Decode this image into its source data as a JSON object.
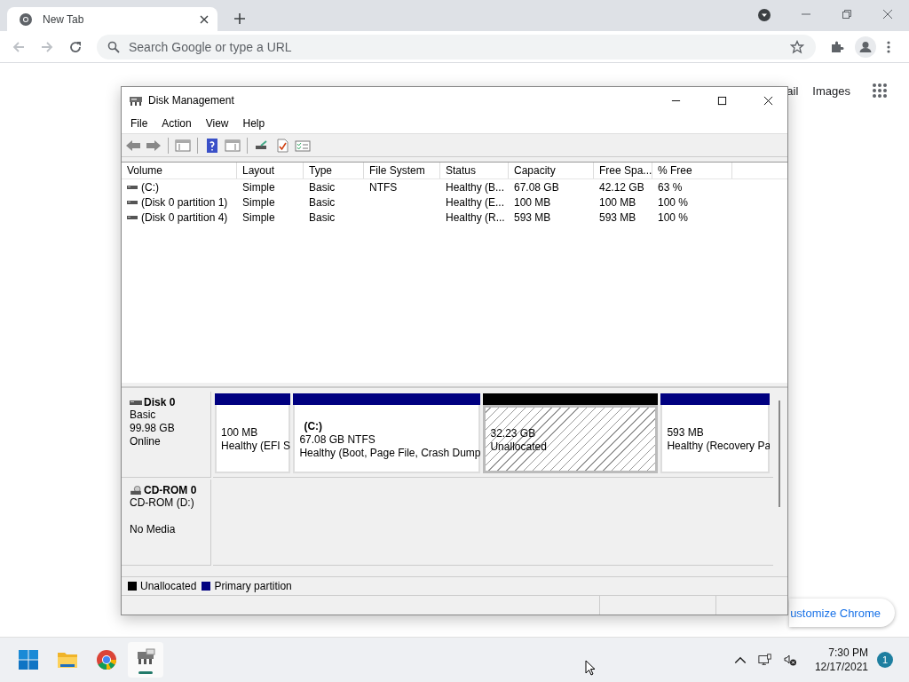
{
  "browser": {
    "tab": {
      "title": "New Tab"
    },
    "address": {
      "placeholder": "Search Google or type a URL"
    }
  },
  "page": {
    "links": [
      "ail",
      "Images"
    ],
    "customize_button": "ustomize Chrome"
  },
  "window": {
    "title": "Disk Management",
    "menu": [
      "File",
      "Action",
      "View",
      "Help"
    ],
    "table": {
      "columns": [
        "Volume",
        "Layout",
        "Type",
        "File System",
        "Status",
        "Capacity",
        "Free Spa...",
        "% Free"
      ],
      "rows": [
        [
          "(C:)",
          "Simple",
          "Basic",
          "NTFS",
          "Healthy (B...",
          "67.08 GB",
          "42.12 GB",
          "63 %"
        ],
        [
          "(Disk 0 partition 1)",
          "Simple",
          "Basic",
          "",
          "Healthy (E...",
          "100 MB",
          "100 MB",
          "100 %"
        ],
        [
          "(Disk 0 partition 4)",
          "Simple",
          "Basic",
          "",
          "Healthy (R...",
          "593 MB",
          "593 MB",
          "100 %"
        ]
      ]
    },
    "disks": [
      {
        "kind": "disk",
        "name": "Disk 0",
        "lines": [
          "Basic",
          "99.98 GB",
          "Online"
        ],
        "partitions": [
          {
            "kind": "primary",
            "selected": false,
            "lines": [
              "100 MB",
              "Healthy (EFI S"
            ]
          },
          {
            "kind": "primary",
            "selected": false,
            "lines": [
              "(C:)",
              "67.08 GB NTFS",
              "Healthy (Boot, Page File, Crash Dump"
            ]
          },
          {
            "kind": "unallocated",
            "selected": true,
            "lines": [
              "32.23 GB",
              "Unallocated"
            ]
          },
          {
            "kind": "primary",
            "selected": false,
            "lines": [
              "593 MB",
              "Healthy (Recovery Pa"
            ]
          }
        ]
      },
      {
        "kind": "cdrom",
        "name": "CD-ROM 0",
        "lines": [
          "CD-ROM (D:)"
        ],
        "media": "No Media"
      }
    ],
    "legend": [
      {
        "label": "Unallocated",
        "color": "#000000"
      },
      {
        "label": "Primary partition",
        "color": "#000080"
      }
    ]
  },
  "taskbar": {
    "time": "7:30 PM",
    "date": "12/17/2021",
    "notifications": "1"
  }
}
